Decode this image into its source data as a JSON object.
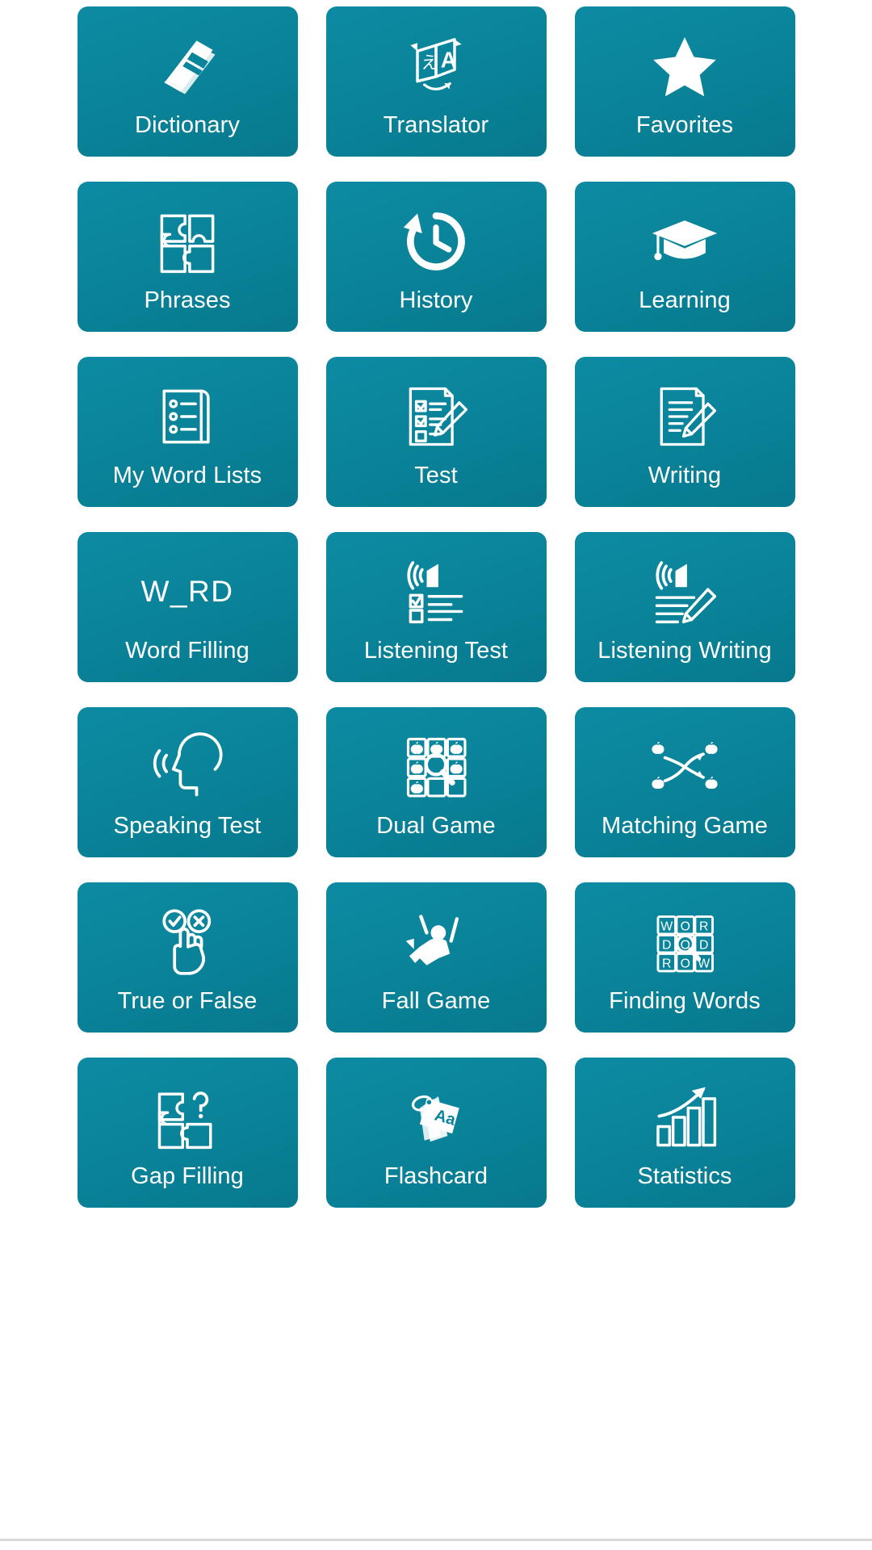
{
  "screen": {
    "title": "Language Learning App Home Grid",
    "background_color": "#ffffff",
    "tile_color_start": "#0d8ba2",
    "tile_color_end": "#07798e",
    "label_color": "#ffffff",
    "columns": 3,
    "rows": 7
  },
  "tiles": [
    {
      "label": "Dictionary",
      "icon": "book-icon"
    },
    {
      "label": "Translator",
      "icon": "translate-icon"
    },
    {
      "label": "Favorites",
      "icon": "star-icon"
    },
    {
      "label": "Phrases",
      "icon": "puzzle-icon"
    },
    {
      "label": "History",
      "icon": "history-clock-icon"
    },
    {
      "label": "Learning",
      "icon": "graduation-cap-icon"
    },
    {
      "label": "My Word Lists",
      "icon": "list-document-icon"
    },
    {
      "label": "Test",
      "icon": "checklist-pencil-icon"
    },
    {
      "label": "Writing",
      "icon": "document-pencil-icon"
    },
    {
      "label": "Word Filling",
      "icon": "w-rd-text-icon",
      "icon_text": "W_RD"
    },
    {
      "label": "Listening Test",
      "icon": "speaker-checklist-icon"
    },
    {
      "label": "Listening Writing",
      "icon": "speaker-pencil-icon"
    },
    {
      "label": "Speaking Test",
      "icon": "speaking-head-icon"
    },
    {
      "label": "Dual Game",
      "icon": "tile-grid-magnifier-icon"
    },
    {
      "label": "Matching Game",
      "icon": "matching-arrows-icon"
    },
    {
      "label": "True or False",
      "icon": "check-cross-hand-icon"
    },
    {
      "label": "Fall Game",
      "icon": "falling-person-icon"
    },
    {
      "label": "Finding Words",
      "icon": "letter-grid-icon",
      "letters": [
        "W",
        "O",
        "R",
        "D",
        "O",
        "D",
        "R",
        "O",
        "W"
      ]
    },
    {
      "label": "Gap Filling",
      "icon": "puzzle-question-icon"
    },
    {
      "label": "Flashcard",
      "icon": "flashcard-icon",
      "icon_text": "Aa"
    },
    {
      "label": "Statistics",
      "icon": "bar-chart-arrow-icon"
    }
  ]
}
